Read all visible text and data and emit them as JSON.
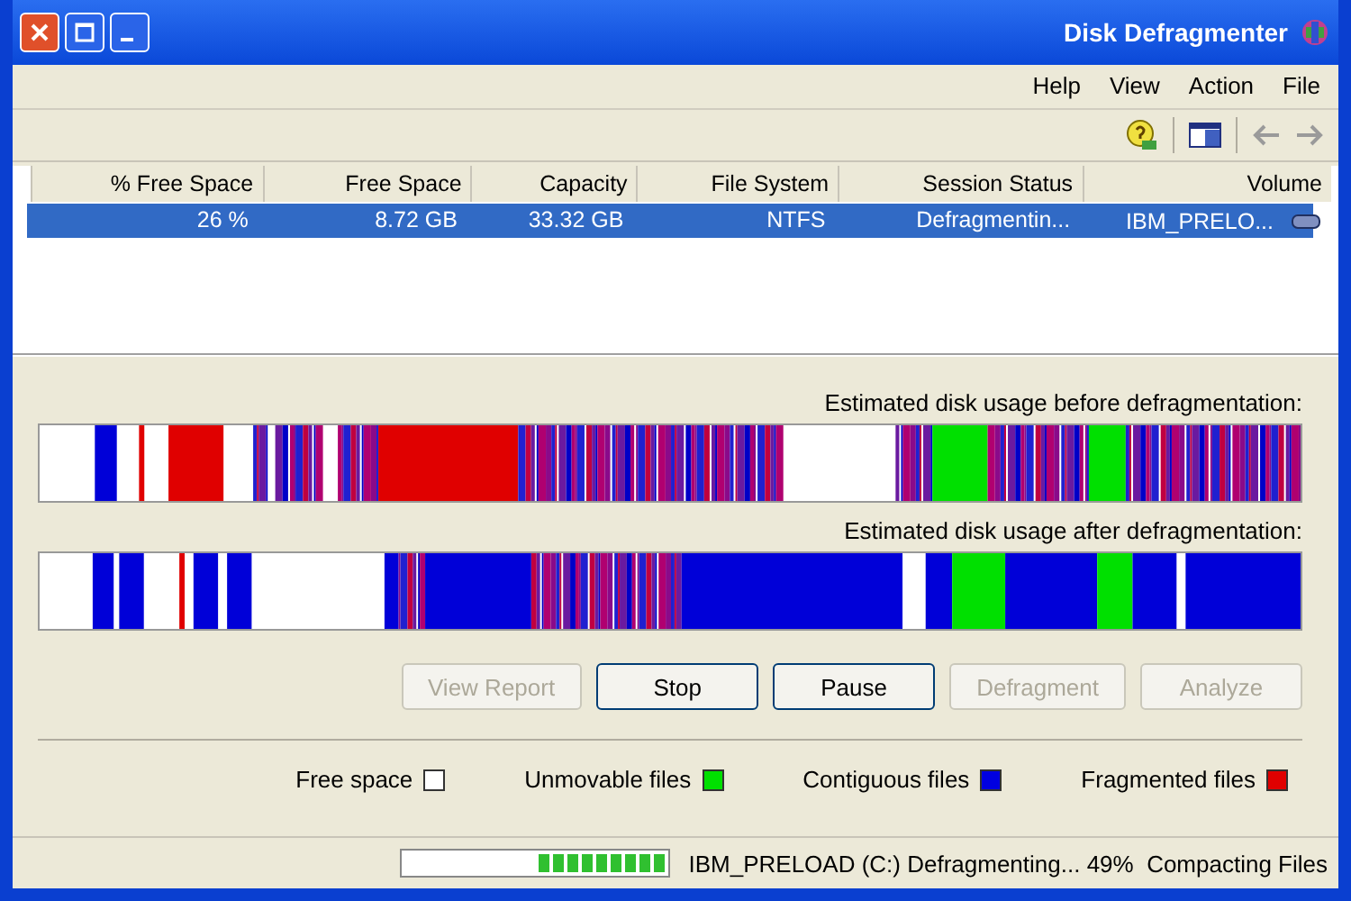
{
  "window": {
    "title": "Disk Defragmenter"
  },
  "menu": [
    "Help",
    "View",
    "Action",
    "File"
  ],
  "table": {
    "columns": [
      "% Free Space",
      "Free Space",
      "Capacity",
      "File System",
      "Session Status",
      "Volume"
    ],
    "rows": [
      {
        "selected": true,
        "cells": [
          "26 %",
          "8.72 GB",
          "33.32 GB",
          "NTFS",
          "Defragmentin...",
          "IBM_PRELO..."
        ]
      }
    ]
  },
  "maps": [
    {
      "label": "Estimated disk usage before defragmentation:"
    },
    {
      "label": "Estimated disk usage after defragmentation:"
    }
  ],
  "buttons": [
    {
      "label": "View Report",
      "disabled": true
    },
    {
      "label": "Stop",
      "disabled": false
    },
    {
      "label": "Pause",
      "disabled": false
    },
    {
      "label": "Defragment",
      "disabled": true
    },
    {
      "label": "Analyze",
      "disabled": true
    }
  ],
  "legend": [
    {
      "label": "Free space",
      "color": "#ffffff"
    },
    {
      "label": "Unmovable files",
      "color": "#00e000"
    },
    {
      "label": "Contiguous files",
      "color": "#0000e0"
    },
    {
      "label": "Fragmented files",
      "color": "#e00000"
    }
  ],
  "status_bar": {
    "text": "IBM_PRELOAD (C:) Defragmenting... 49%  Compacting Files",
    "level": 0.49
  }
}
